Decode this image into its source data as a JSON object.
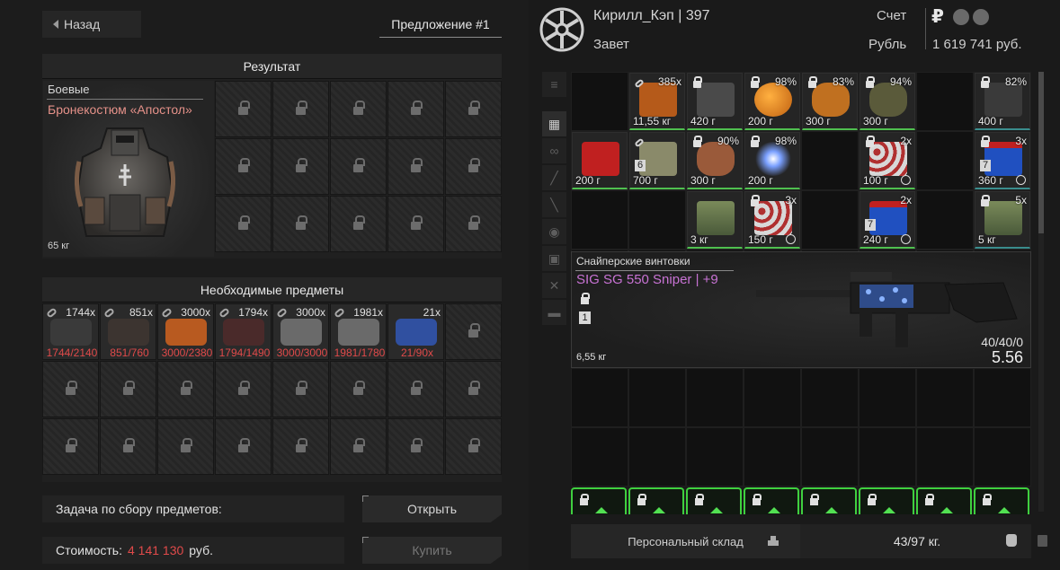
{
  "left": {
    "back_label": "Назад",
    "offer_tab": "Предложение #1",
    "result_header": "Результат",
    "result_item": {
      "category": "Боевые",
      "name": "Бронекостюм «Апостол»",
      "weight": "65 кг"
    },
    "required_header": "Необходимые предметы",
    "required_items": [
      {
        "count": "1744x",
        "progress": "1744/2140"
      },
      {
        "count": "851x",
        "progress": "851/760"
      },
      {
        "count": "3000x",
        "progress": "3000/2380"
      },
      {
        "count": "1794x",
        "progress": "1794/1490"
      },
      {
        "count": "3000x",
        "progress": "3000/3000"
      },
      {
        "count": "1981x",
        "progress": "1981/1780"
      },
      {
        "count": "21x",
        "progress": "21/90x"
      }
    ],
    "task_label": "Задача по сбору предметов:",
    "open_button": "Открыть",
    "cost_label": "Стоимость:",
    "cost_value": "4 141 130",
    "cost_currency": "руб.",
    "buy_button": "Купить"
  },
  "right": {
    "player_name": "Кирилл_Кэп | 397",
    "faction": "Завет",
    "account_label": "Счет",
    "currency_label": "Рубль",
    "rub_icon": "₽",
    "money": "1 619 741 руб.",
    "side_tabs": [
      "sort-icon",
      "grid-icon",
      "link-icon",
      "rifle-icon",
      "knife-icon",
      "artifact-icon",
      "camera-icon",
      "tools-icon",
      "box-icon"
    ],
    "grid_items": [
      {
        "weight": "",
        "tl": ""
      },
      {
        "weight": "11,55 кг",
        "tl": "385x"
      },
      {
        "weight": "420 г",
        "tl": ""
      },
      {
        "weight": "200 г",
        "tl": "98%"
      },
      {
        "weight": "300 г",
        "tl": "83%"
      },
      {
        "weight": "300 г",
        "tl": "94%"
      },
      {
        "weight": "400 г",
        "tl": "82%"
      },
      {
        "weight": "200 г",
        "tl": ""
      },
      {
        "weight": "700 г",
        "tl": ""
      },
      {
        "weight": "300 г",
        "tl": "90%"
      },
      {
        "weight": "200 г",
        "tl": "98%"
      },
      {
        "weight": "100 г",
        "tl": "2x"
      },
      {
        "weight": "360 г",
        "tl": "3x"
      },
      {
        "weight": "3 кг",
        "tl": ""
      },
      {
        "weight": "150 г",
        "tl": "3x"
      },
      {
        "weight": "240 г",
        "tl": "2x"
      },
      {
        "weight": "5 кг",
        "tl": "5x"
      }
    ],
    "level_badges": [
      "6",
      "7",
      "7"
    ],
    "weapon": {
      "category": "Снайперские винтовки",
      "name": "SIG SG 550 Sniper | +9",
      "level": "1",
      "weight": "6,55 кг",
      "ammo": "40/40/0",
      "value": "5.56"
    },
    "stash_label": "Персональный склад",
    "stash_weight": "43/97 кг."
  },
  "colors": {
    "accent_red": "#e04a4a",
    "item_name_red": "#e59189",
    "weapon_purple": "#c873d4",
    "slot_green": "#3fd03f"
  }
}
